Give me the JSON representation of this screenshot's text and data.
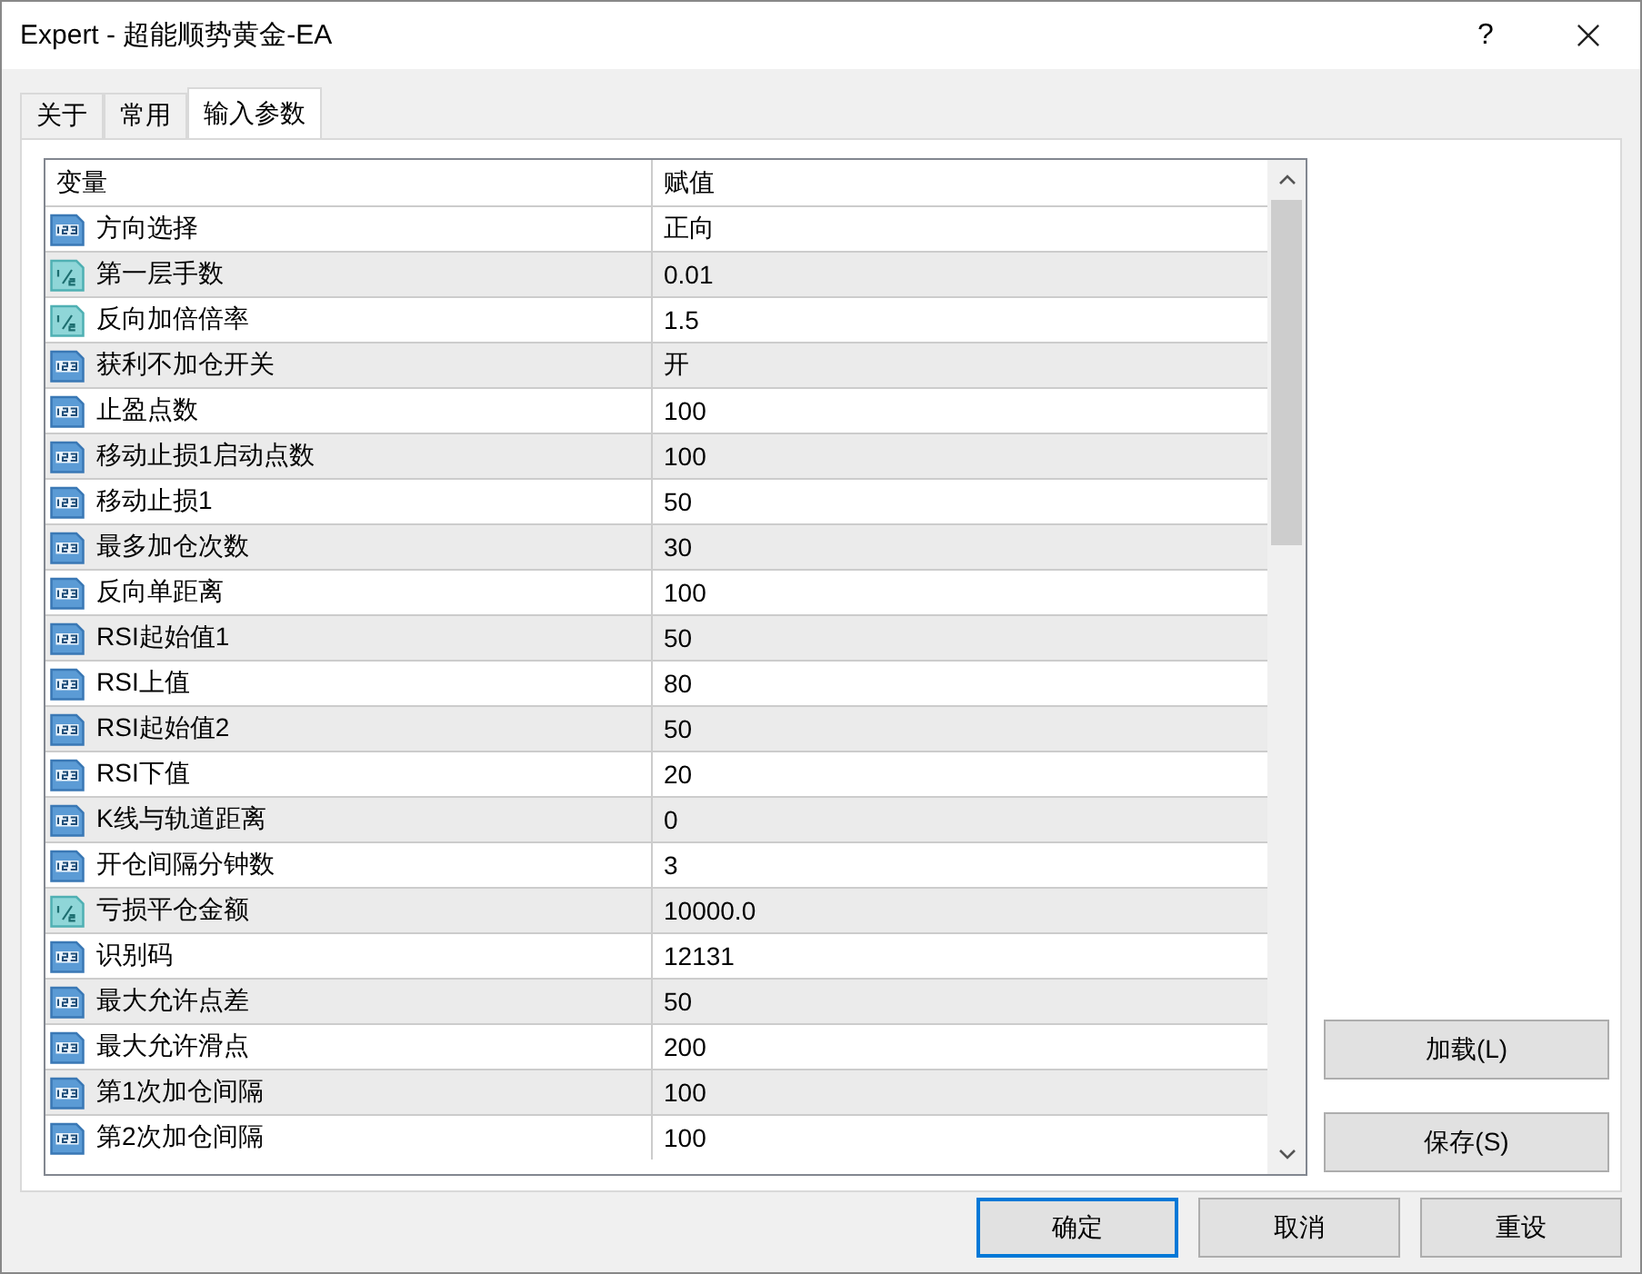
{
  "window": {
    "title": "Expert - 超能顺势黄金-EA",
    "help": "?"
  },
  "tabs": [
    {
      "label": "关于",
      "selected": false
    },
    {
      "label": "常用",
      "selected": false
    },
    {
      "label": "输入参数",
      "selected": true
    }
  ],
  "table": {
    "columns": [
      "变量",
      "赋值"
    ],
    "rows": [
      {
        "kind": "int",
        "name": "方向选择",
        "value": "正向"
      },
      {
        "kind": "double",
        "name": "第一层手数",
        "value": "0.01"
      },
      {
        "kind": "double",
        "name": "反向加倍倍率",
        "value": "1.5"
      },
      {
        "kind": "int",
        "name": "获利不加仓开关",
        "value": "开"
      },
      {
        "kind": "int",
        "name": "止盈点数",
        "value": "100"
      },
      {
        "kind": "int",
        "name": "移动止损1启动点数",
        "value": "100"
      },
      {
        "kind": "int",
        "name": "移动止损1",
        "value": "50"
      },
      {
        "kind": "int",
        "name": "最多加仓次数",
        "value": "30"
      },
      {
        "kind": "int",
        "name": "反向单距离",
        "value": "100"
      },
      {
        "kind": "int",
        "name": "RSI起始值1",
        "value": "50"
      },
      {
        "kind": "int",
        "name": "RSI上值",
        "value": "80"
      },
      {
        "kind": "int",
        "name": "RSI起始值2",
        "value": "50"
      },
      {
        "kind": "int",
        "name": "RSI下值",
        "value": "20"
      },
      {
        "kind": "int",
        "name": "K线与轨道距离",
        "value": "0"
      },
      {
        "kind": "int",
        "name": "开仓间隔分钟数",
        "value": "3"
      },
      {
        "kind": "double",
        "name": "亏损平仓金额",
        "value": "10000.0"
      },
      {
        "kind": "int",
        "name": "识别码",
        "value": "12131"
      },
      {
        "kind": "int",
        "name": "最大允许点差",
        "value": "50"
      },
      {
        "kind": "int",
        "name": "最大允许滑点",
        "value": "200"
      },
      {
        "kind": "int",
        "name": "第1次加仓间隔",
        "value": "100"
      },
      {
        "kind": "int",
        "name": "第2次加仓间隔",
        "value": "100"
      }
    ]
  },
  "side_buttons": [
    "加载(L)",
    "保存(S)"
  ],
  "buttons": [
    {
      "label": "确定",
      "selected": true
    },
    {
      "label": "取消",
      "selected": false
    },
    {
      "label": "重设",
      "selected": false
    }
  ]
}
